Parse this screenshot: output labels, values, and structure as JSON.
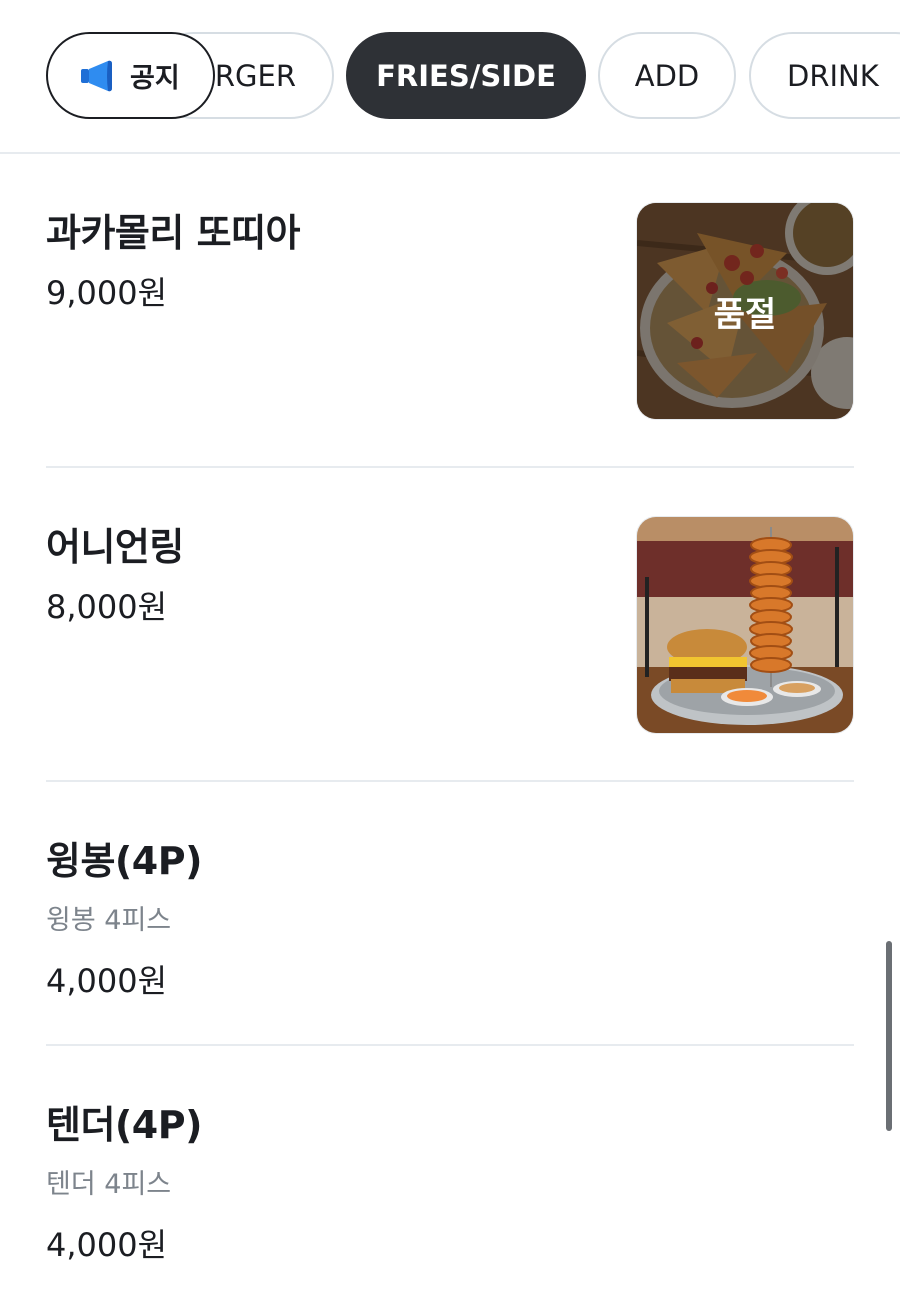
{
  "notice": {
    "label": "공지",
    "icon": "megaphone-icon"
  },
  "tabs": [
    {
      "label": "BURGER",
      "visible_label": "RGER",
      "active": false
    },
    {
      "label": "FRIES/SIDE",
      "active": true
    },
    {
      "label": "ADD",
      "active": false
    },
    {
      "label": "DRINK",
      "active": false
    }
  ],
  "items": [
    {
      "name": "과카몰리 또띠아",
      "price": "9,000원",
      "sold_out_label": "품절",
      "sold_out": true
    },
    {
      "name": "어니언링",
      "price": "8,000원"
    },
    {
      "name": "윙봉(4P)",
      "description": "윙봉 4피스",
      "price": "4,000원"
    },
    {
      "name": "텐더(4P)",
      "description": "텐더 4피스",
      "price": "4,000원"
    }
  ],
  "colors": {
    "active_tab_bg": "#2e3136",
    "notice_icon": "#2f8cf0",
    "divider": "#e7ebef",
    "muted_text": "#7d848c"
  }
}
